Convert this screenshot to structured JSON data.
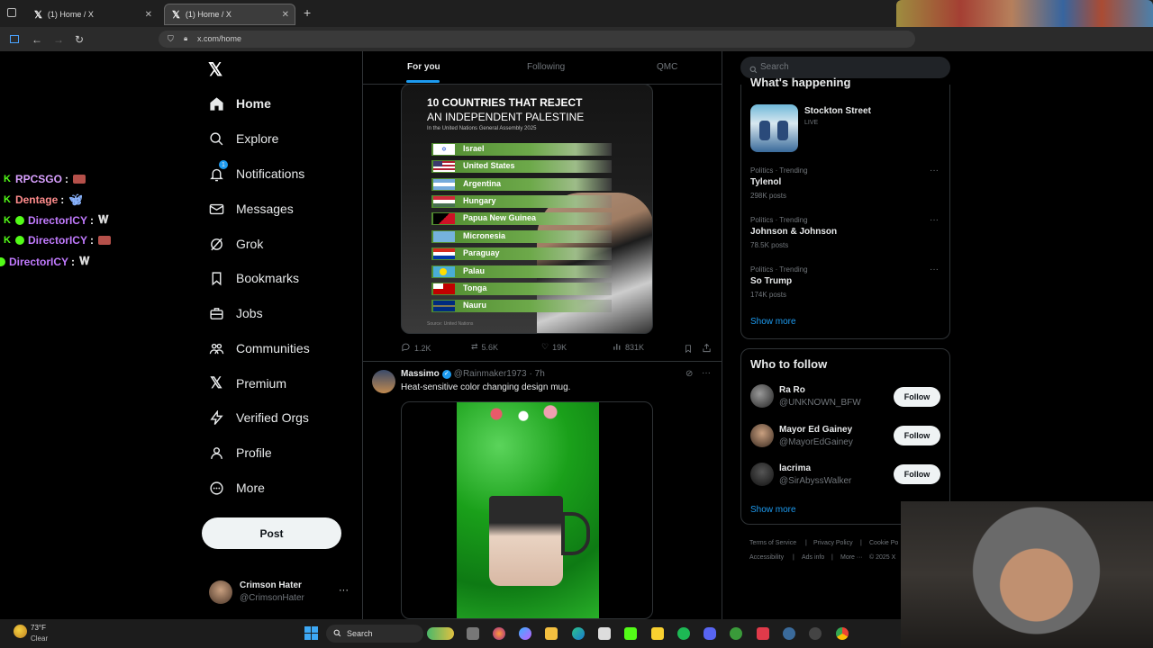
{
  "browser": {
    "tabs": [
      {
        "title": "(1) Home / X"
      },
      {
        "title": "(1) Home / X"
      }
    ],
    "url": "x.com/home"
  },
  "chat": [
    {
      "user": "RPCSGO",
      "color": "#d9a0ff"
    },
    {
      "user": "Dentage",
      "color": "#ff8c8c"
    },
    {
      "user": "DirectorICY",
      "color": "#c27bff"
    },
    {
      "user": "DirectorICY",
      "color": "#c27bff"
    },
    {
      "user": "DirectorICY",
      "color": "#c27bff"
    }
  ],
  "sidebar": {
    "items": [
      {
        "label": "Home"
      },
      {
        "label": "Explore"
      },
      {
        "label": "Notifications"
      },
      {
        "label": "Messages"
      },
      {
        "label": "Grok"
      },
      {
        "label": "Bookmarks"
      },
      {
        "label": "Jobs"
      },
      {
        "label": "Communities"
      },
      {
        "label": "Premium"
      },
      {
        "label": "Verified Orgs"
      },
      {
        "label": "Profile"
      },
      {
        "label": "More"
      }
    ],
    "post_label": "Post",
    "account": {
      "name": "Crimson Hater",
      "handle": "@CrimsonHater"
    }
  },
  "feed": {
    "tabs": [
      "For you",
      "Following",
      "QMC"
    ],
    "infographic": {
      "title_line1": "10 COUNTRIES THAT REJECT",
      "title_line2": "AN INDEPENDENT PALESTINE",
      "subtitle": "In the United Nations General Assembly 2025",
      "countries": [
        "Israel",
        "United States",
        "Argentina",
        "Hungary",
        "Papua New Guinea",
        "Micronesia",
        "Paraguay",
        "Palau",
        "Tonga",
        "Nauru"
      ],
      "source": "Source: United Nations"
    },
    "post1_stats": {
      "replies": "1.2K",
      "reposts": "5.6K",
      "likes": "19K",
      "views": "831K"
    },
    "post2": {
      "author": "Massimo",
      "handle": "@Rainmaker1973",
      "time": "· 7h",
      "text": "Heat-sensitive color changing design mug."
    }
  },
  "right": {
    "search_placeholder": "Search",
    "happening_title": "What's happening",
    "live": {
      "name": "Stockton Street",
      "status": "LIVE"
    },
    "trends": [
      {
        "category": "Politics · Trending",
        "name": "Tylenol",
        "count": "298K posts"
      },
      {
        "category": "Politics · Trending",
        "name": "Johnson & Johnson",
        "count": "78.5K posts"
      },
      {
        "category": "Politics · Trending",
        "name": "So Trump",
        "count": "174K posts"
      }
    ],
    "show_more": "Show more",
    "wtf_title": "Who to follow",
    "follow_label": "Follow",
    "suggestions": [
      {
        "name": "Ra Ro",
        "handle": "@UNKNOWN_BFW"
      },
      {
        "name": "Mayor Ed Gainey",
        "handle": "@MayorEdGainey"
      },
      {
        "name": "lacrima",
        "handle": "@SirAbyssWalker"
      }
    ],
    "footer": {
      "terms": "Terms of Service",
      "privacy": "Privacy Policy",
      "cookie": "Cookie Po",
      "accessibility": "Accessibility",
      "ads": "Ads info",
      "more": "More ···",
      "copyright": "© 2025 X"
    }
  },
  "taskbar": {
    "weather_temp": "73°F",
    "weather_desc": "Clear",
    "search_label": "Search"
  }
}
